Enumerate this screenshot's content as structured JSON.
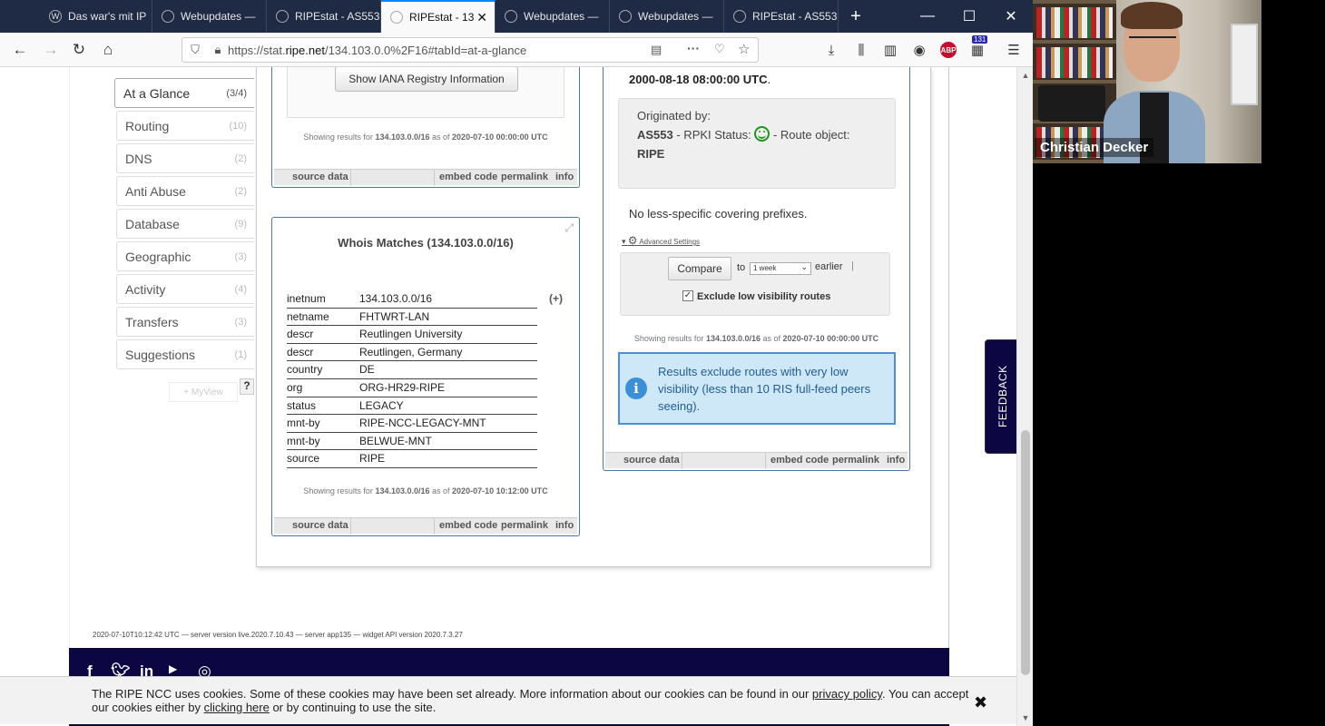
{
  "browser": {
    "tabs": [
      {
        "label": "Das war's mit IP",
        "active": false
      },
      {
        "label": "Webupdates —",
        "active": false
      },
      {
        "label": "RIPEstat - AS553",
        "active": false
      },
      {
        "label": "RIPEstat - 13",
        "active": true
      },
      {
        "label": "Webupdates —",
        "active": false
      },
      {
        "label": "Webupdates —",
        "active": false
      },
      {
        "label": "RIPEstat - AS553",
        "active": false
      }
    ],
    "new_tab": "+",
    "url_prefix": "https://stat.",
    "url_host": "ripe.net",
    "url_path": "/134.103.0.0%2F16#tabId=at-a-glance",
    "notification_count": "131",
    "abp_label": "ABP"
  },
  "sidebar": {
    "items": [
      {
        "label": "At a Glance",
        "count": "(3/4)"
      },
      {
        "label": "Routing",
        "count": "(10)"
      },
      {
        "label": "DNS",
        "count": "(2)"
      },
      {
        "label": "Anti Abuse",
        "count": "(2)"
      },
      {
        "label": "Database",
        "count": "(9)"
      },
      {
        "label": "Geographic",
        "count": "(3)"
      },
      {
        "label": "Activity",
        "count": "(4)"
      },
      {
        "label": "Transfers",
        "count": "(3)"
      },
      {
        "label": "Suggestions",
        "count": "(1)"
      }
    ],
    "myview": "+ MyView",
    "help": "?"
  },
  "iana_widget": {
    "button": "Show IANA Registry Information",
    "showing_prefix": "Showing results for",
    "prefix": "134.103.0.0/16",
    "as_of": "as of",
    "timestamp": "2020-07-10 00:00:00 UTC"
  },
  "widget_footer": {
    "source": "source data",
    "embed": "embed code",
    "permalink": "permalink",
    "info": "info"
  },
  "whois_widget": {
    "title": "Whois Matches (134.103.0.0/16)",
    "plus": "(+)",
    "rows": [
      {
        "key": "inetnum",
        "value": "134.103.0.0/16"
      },
      {
        "key": "netname",
        "value": "FHTWRT-LAN"
      },
      {
        "key": "descr",
        "value": "Reutlingen University"
      },
      {
        "key": "descr",
        "value": "Reutlingen, Germany"
      },
      {
        "key": "country",
        "value": "DE"
      },
      {
        "key": "org",
        "value": "ORG-HR29-RIPE"
      },
      {
        "key": "status",
        "value": "LEGACY"
      },
      {
        "key": "mnt-by",
        "value": "RIPE-NCC-LEGACY-MNT"
      },
      {
        "key": "mnt-by",
        "value": "BELWUE-MNT"
      },
      {
        "key": "source",
        "value": "RIPE"
      }
    ],
    "showing_prefix": "Showing results for",
    "prefix": "134.103.0.0/16",
    "as_of": "as of",
    "timestamp": "2020-07-10 10:12:00 UTC"
  },
  "routing_widget": {
    "date_line": "2000-08-18 08:00:00 UTC",
    "date_suffix": ".",
    "originated_by": "Originated by:",
    "asn": "AS553",
    "rpki_label": " - RPKI Status: ",
    "route_object_label": " - Route object:",
    "route_object": "RIPE",
    "no_less_specific": "No less-specific covering prefixes.",
    "advanced_settings": "Advanced Settings",
    "compare_button": "Compare",
    "to": "to",
    "period": "1 week",
    "earlier": "earlier",
    "separator": "|",
    "exclude_label": "Exclude low visibility routes",
    "exclude_checked": true,
    "showing_prefix": "Showing results for",
    "prefix": "134.103.0.0/16",
    "as_of": "as of",
    "timestamp": "2020-07-10 00:00:00 UTC",
    "info_text": "Results exclude routes with very low visibility (less than 10 RIS full-feed peers seeing)."
  },
  "server_info": "2020-07-10T10:12:42 UTC — server version live.2020.7.10.43 — server app135 — widget API version 2020.7.3.27",
  "feedback": "FEEDBACK",
  "cookie": {
    "text1": "The RIPE NCC uses cookies. Some of these cookies may have been set already. More information about our cookies can be found in our ",
    "privacy_link": "privacy policy",
    "text2": ". You can accept our cookies either by ",
    "clicking_link": "clicking here",
    "text3": " or by continuing to use the site.",
    "close": "✖"
  },
  "webcam": {
    "name": "Christian Decker"
  },
  "colors": {
    "footer_navy": "#0c0642",
    "widget_border": "#4a77b4",
    "info_bg": "#cfe8f8",
    "rpki_green": "#1a9a1a"
  }
}
